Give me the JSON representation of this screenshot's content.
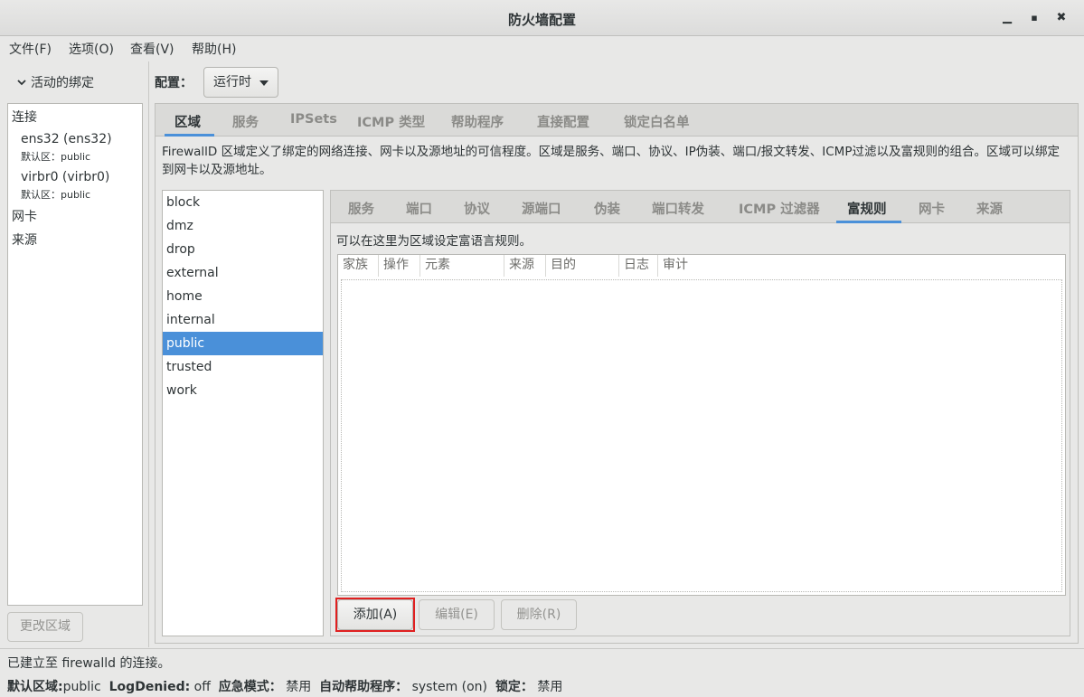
{
  "window": {
    "title": "防火墙配置",
    "minimize": "▁",
    "maximize": "▪",
    "close": "✖"
  },
  "menu": [
    "文件(F)",
    "选项(O)",
    "查看(V)",
    "帮助(H)"
  ],
  "bindings": {
    "header": "活动的绑定",
    "connections_label": "连接",
    "connections": [
      {
        "name": "ens32 (ens32)",
        "zone": "默认区：public"
      },
      {
        "name": "virbr0 (virbr0)",
        "zone": "默认区：public"
      }
    ],
    "interfaces_label": "网卡",
    "sources_label": "来源",
    "change_zone_button": "更改区域"
  },
  "config": {
    "label": "配置：",
    "value": "运行时"
  },
  "main_tabs": [
    "区域",
    "服务",
    "IPSets",
    "ICMP 类型",
    "帮助程序",
    "直接配置",
    "锁定白名单"
  ],
  "main_tab_active": "区域",
  "zone_description": "FirewallD 区域定义了绑定的网络连接、网卡以及源地址的可信程度。区域是服务、端口、协议、IP伪装、端口/报文转发、ICMP过滤以及富规则的组合。区域可以绑定到网卡以及源地址。",
  "zones": [
    "block",
    "dmz",
    "drop",
    "external",
    "home",
    "internal",
    "public",
    "trusted",
    "work"
  ],
  "selected_zone": "public",
  "zone_tabs": [
    "服务",
    "端口",
    "协议",
    "源端口",
    "伪装",
    "端口转发",
    "ICMP 过滤器",
    "富规则",
    "网卡",
    "来源"
  ],
  "zone_tab_active": "富规则",
  "rich_rules": {
    "description": "可以在这里为区域设定富语言规则。",
    "columns": [
      "家族",
      "操作",
      "元素",
      "来源",
      "目的",
      "日志",
      "审计"
    ],
    "rows": [],
    "buttons": {
      "add": "添加(A)",
      "edit": "编辑(E)",
      "delete": "删除(R)"
    }
  },
  "status": {
    "connection": "已建立至  firewalld 的连接。",
    "default_zone_label": "默认区域:",
    "default_zone": "public",
    "logdenied_label": "LogDenied:",
    "logdenied": "off",
    "panic_label": "应急模式：",
    "panic": "禁用",
    "helpers_label": "自动帮助程序：",
    "helpers": "system (on)",
    "lockdown_label": "锁定：",
    "lockdown": "禁用"
  }
}
